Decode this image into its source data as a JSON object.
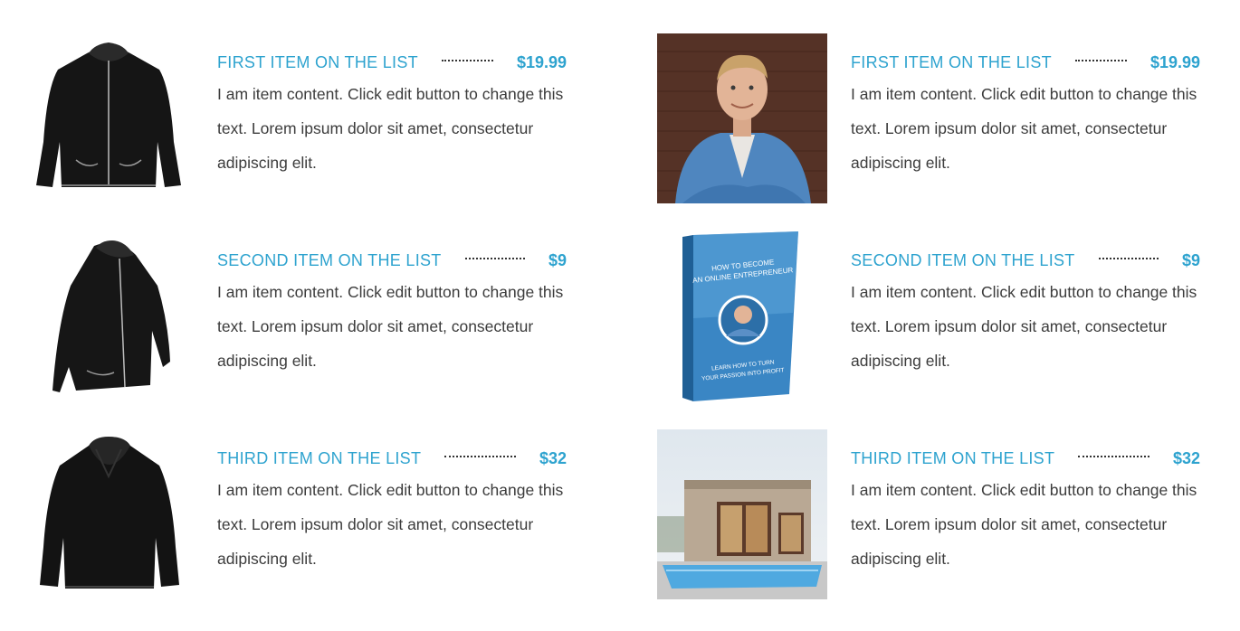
{
  "left_column": {
    "items": [
      {
        "title": "FIRST ITEM ON THE LIST",
        "price": "$19.99",
        "description": "I am item content. Click edit button to change this text. Lorem ipsum dolor sit amet, consectetur adipiscing elit.",
        "image": "black-zip-hoodie"
      },
      {
        "title": "SECOND ITEM ON THE LIST",
        "price": "$9",
        "description": "I am item content. Click edit button to change this text. Lorem ipsum dolor sit amet, consectetur adipiscing elit.",
        "image": "black-zip-hoodie-side"
      },
      {
        "title": "THIRD ITEM ON THE LIST",
        "price": "$32",
        "description": "I am item content. Click edit button to change this text. Lorem ipsum dolor sit amet, consectetur adipiscing elit.",
        "image": "black-pullover-hoodie"
      }
    ]
  },
  "right_column": {
    "items": [
      {
        "title": "FIRST ITEM ON THE LIST",
        "price": "$19.99",
        "description": "I am item content. Click edit button to change this text. Lorem ipsum dolor sit amet, consectetur adipiscing elit.",
        "image": "man-portrait-photo"
      },
      {
        "title": "SECOND ITEM ON THE LIST",
        "price": "$9",
        "description": "I am item content. Click edit button to change this text. Lorem ipsum dolor sit amet, consectetur adipiscing elit.",
        "image": "ebook-cover"
      },
      {
        "title": "THIRD ITEM ON THE LIST",
        "price": "$32",
        "description": "I am item content. Click edit button to change this text. Lorem ipsum dolor sit amet, consectetur adipiscing elit.",
        "image": "modern-house-photo"
      }
    ]
  },
  "book_cover": {
    "title_line1": "HOW TO BECOME",
    "title_line2": "AN ONLINE ENTREPRENEUR",
    "subtitle_line1": "LEARN HOW TO TURN",
    "subtitle_line2": "YOUR PASSION INTO PROFIT"
  },
  "colors": {
    "accent": "#2ea3cf",
    "body_text": "#3c3c3c",
    "leader_dots": "#333333"
  }
}
